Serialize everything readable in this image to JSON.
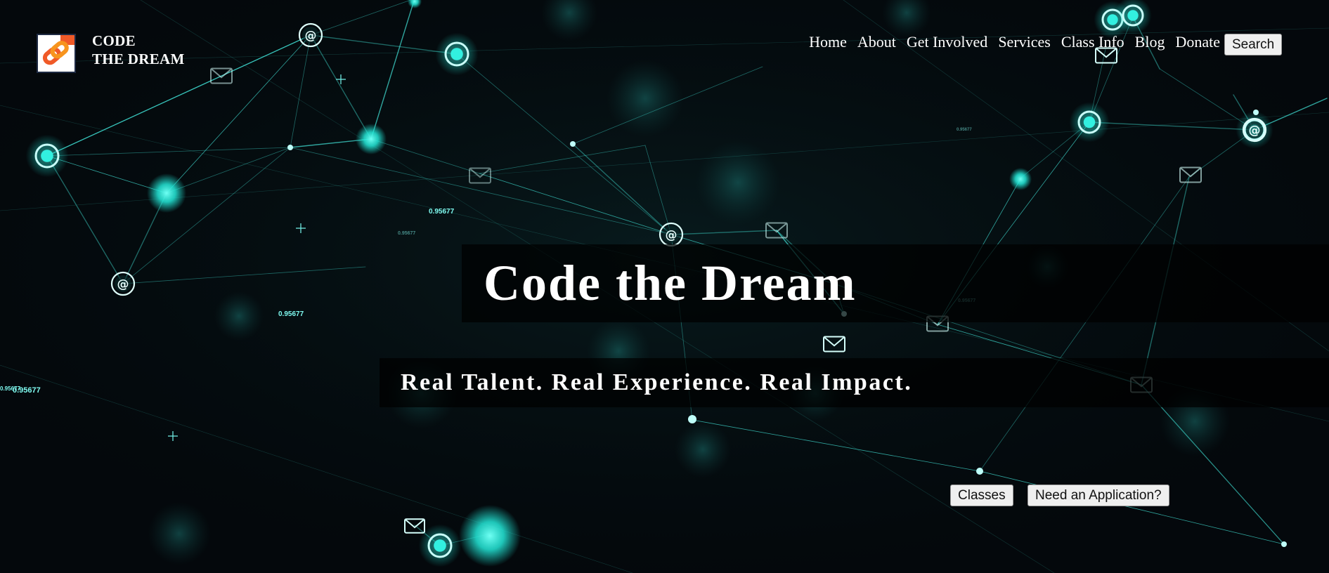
{
  "brand": {
    "line1": "CODE",
    "line2": "THE DREAM",
    "logo_icon": "chain-link-icon",
    "logo_colors": [
      "#1e2a44",
      "#f05a28",
      "#f7941d",
      "#ffffff"
    ]
  },
  "nav": {
    "items": [
      "Home",
      "About",
      "Get Involved",
      "Services",
      "Class Info",
      "Blog",
      "Donate"
    ],
    "search_label": "Search"
  },
  "hero": {
    "title": "Code the Dream",
    "tagline": "Real Talent. Real Experience. Real Impact.",
    "background": "network-connections-image",
    "floating_label": "0.95677"
  },
  "cta": {
    "classes_label": "Classes",
    "application_label": "Need an Application?"
  },
  "colors": {
    "background": "#04080c",
    "accent": "#2ff5e6",
    "text": "#ffffff"
  }
}
